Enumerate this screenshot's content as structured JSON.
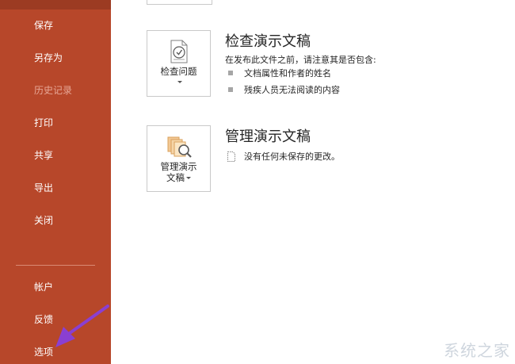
{
  "sidebar": {
    "items": [
      {
        "label": "保存"
      },
      {
        "label": "另存为"
      },
      {
        "label": "历史记录"
      },
      {
        "label": "打印"
      },
      {
        "label": "共享"
      },
      {
        "label": "导出"
      },
      {
        "label": "关闭"
      },
      {
        "label": "帐户"
      },
      {
        "label": "反馈"
      },
      {
        "label": "选项"
      }
    ]
  },
  "inspect": {
    "button_label": "检查问题",
    "title": "检查演示文稿",
    "description": "在发布此文件之前，请注意其是否包含:",
    "bullets": [
      "文档属性和作者的姓名",
      "残疾人员无法阅读的内容"
    ]
  },
  "manage": {
    "button_line1": "管理演示",
    "button_line2": "文稿",
    "title": "管理演示文稿",
    "status": "没有任何未保存的更改。"
  },
  "watermark": {
    "text": "系统之家"
  },
  "colors": {
    "sidebar_bg": "#b7472a",
    "annotation_arrow": "#8a3fd1"
  }
}
